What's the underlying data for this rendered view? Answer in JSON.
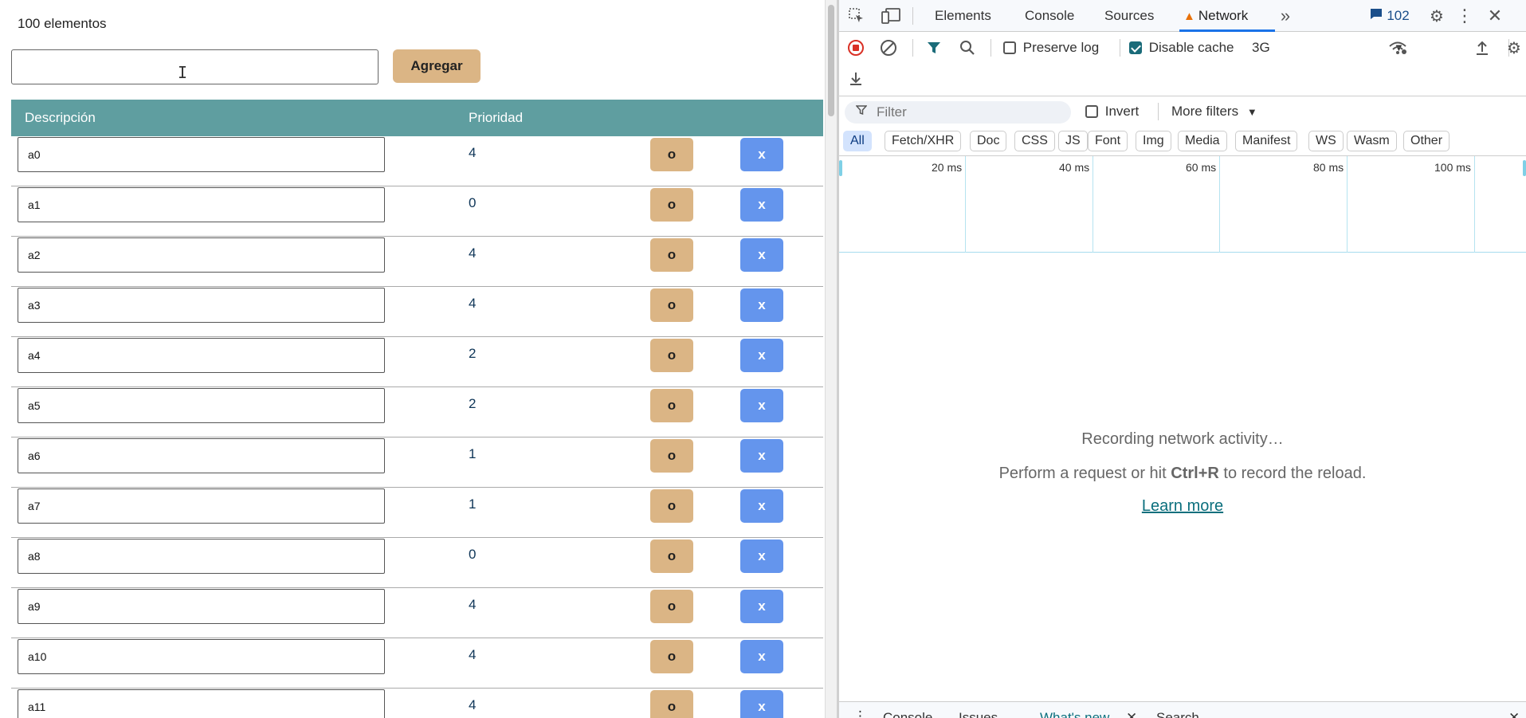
{
  "app": {
    "count_text": "100 elementos",
    "new_item_value": "",
    "add_label": "Agregar",
    "columns": {
      "description": "Descripción",
      "priority": "Prioridad"
    },
    "edit_label": "o",
    "delete_label": "x",
    "rows": [
      {
        "desc": "a0",
        "prio": "4"
      },
      {
        "desc": "a1",
        "prio": "0"
      },
      {
        "desc": "a2",
        "prio": "4"
      },
      {
        "desc": "a3",
        "prio": "4"
      },
      {
        "desc": "a4",
        "prio": "2"
      },
      {
        "desc": "a5",
        "prio": "2"
      },
      {
        "desc": "a6",
        "prio": "1"
      },
      {
        "desc": "a7",
        "prio": "1"
      },
      {
        "desc": "a8",
        "prio": "0"
      },
      {
        "desc": "a9",
        "prio": "4"
      },
      {
        "desc": "a10",
        "prio": "4"
      },
      {
        "desc": "a11",
        "prio": "4"
      }
    ],
    "colors": {
      "header": "#5f9ea0",
      "edit_button": "#dbb585",
      "delete_button": "#6495ed"
    }
  },
  "devtools": {
    "tabs": [
      "Elements",
      "Console",
      "Sources",
      "Network"
    ],
    "active_tab": "Network",
    "messages_count": "102",
    "toolbar": {
      "preserve_log": "Preserve log",
      "preserve_log_checked": false,
      "disable_cache": "Disable cache",
      "disable_cache_checked": true,
      "throttling": "3G"
    },
    "filter": {
      "placeholder": "Filter",
      "invert": "Invert",
      "more_filters": "More filters",
      "types": [
        "All",
        "Fetch/XHR",
        "Doc",
        "CSS",
        "JS",
        "Font",
        "Img",
        "Media",
        "Manifest",
        "WS",
        "Wasm",
        "Other"
      ],
      "active_type": "All"
    },
    "timeline_labels": [
      "20 ms",
      "40 ms",
      "60 ms",
      "80 ms",
      "100 ms"
    ],
    "empty": {
      "recording": "Recording network activity…",
      "hint_prefix": "Perform a request or hit ",
      "hint_shortcut": "Ctrl+R",
      "hint_suffix": " to record the reload.",
      "learn_more": "Learn more"
    },
    "drawer_tabs": [
      "Console",
      "Issues",
      "What's new",
      "Search"
    ],
    "icons": [
      "inspect-icon",
      "device-toggle-icon",
      "more-tabs-icon",
      "messages-icon",
      "settings-icon",
      "kebab-menu-icon",
      "close-icon",
      "record-stop-icon",
      "clear-icon",
      "filter-icon",
      "search-icon",
      "network-conditions-icon",
      "import-har-icon",
      "export-har-icon",
      "network-settings-icon"
    ]
  }
}
